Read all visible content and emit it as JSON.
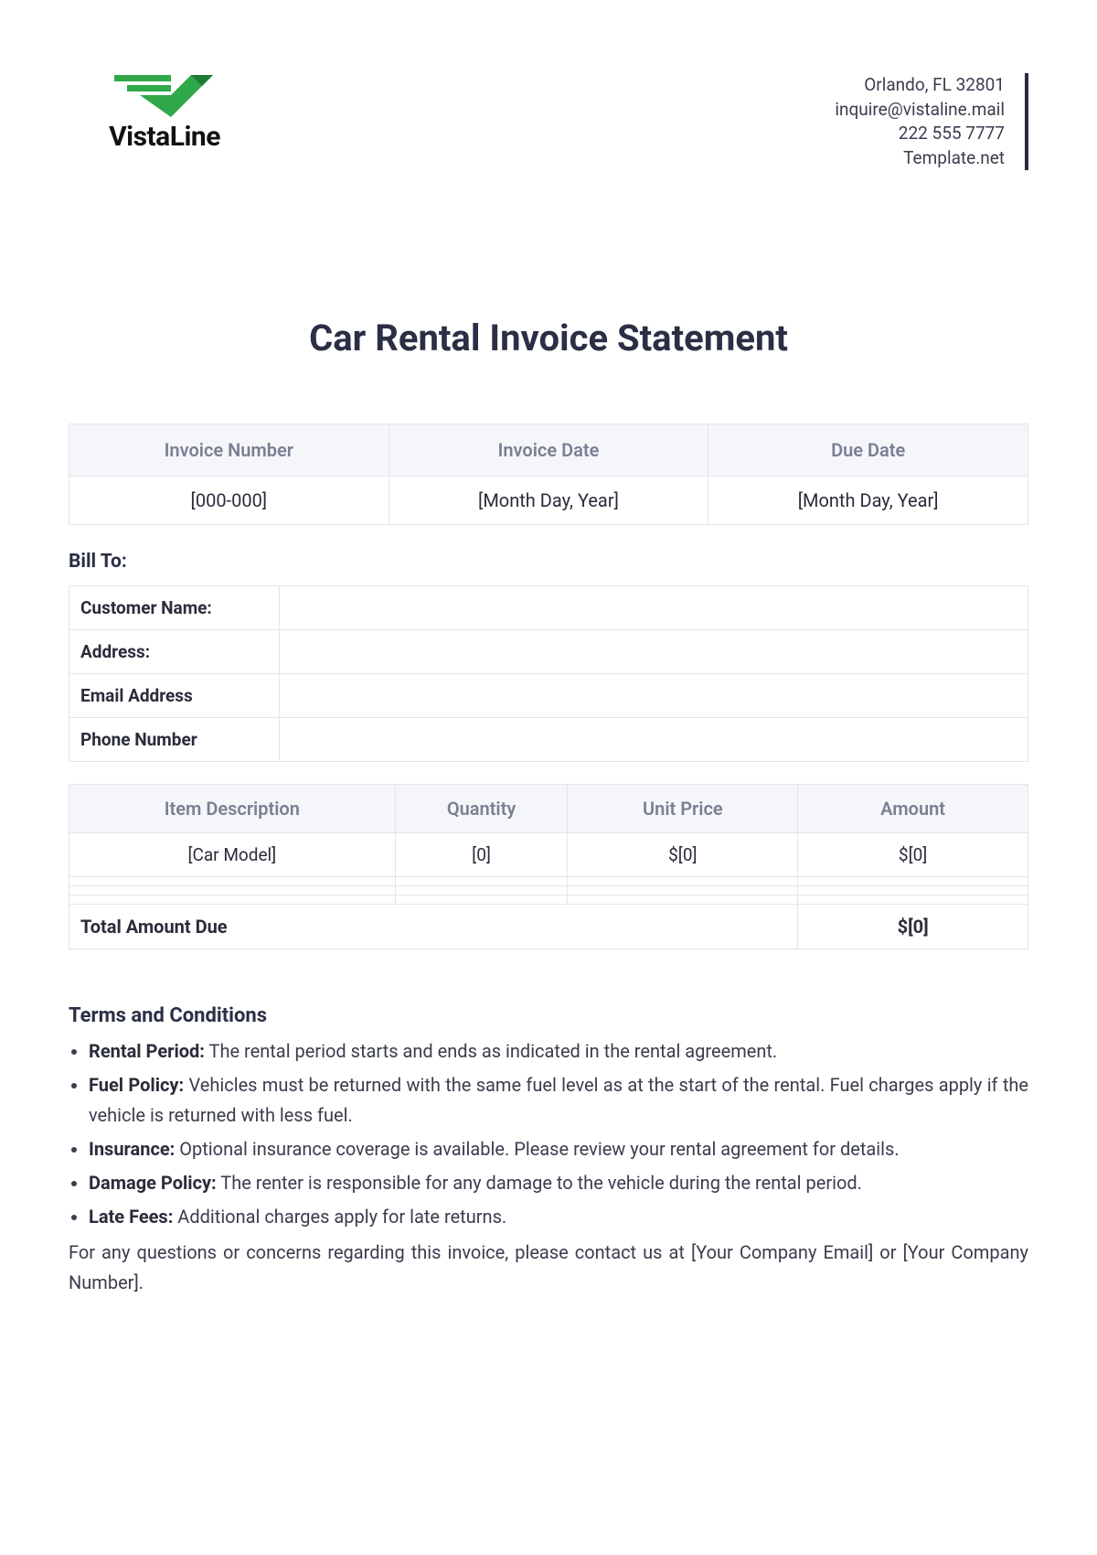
{
  "company": {
    "name": "VistaLine",
    "address": "Orlando, FL 32801",
    "email": "inquire@vistaline.mail",
    "phone": "222 555 7777",
    "site": "Template.net"
  },
  "title": "Car Rental Invoice Statement",
  "meta": {
    "headers": {
      "invoice_no": "Invoice Number",
      "invoice_date": "Invoice Date",
      "due_date": "Due Date"
    },
    "values": {
      "invoice_no": "[000-000]",
      "invoice_date": "[Month Day, Year]",
      "due_date": "[Month Day, Year]"
    }
  },
  "bill_to": {
    "heading": "Bill To:",
    "rows": [
      {
        "label": "Customer Name:",
        "value": ""
      },
      {
        "label": "Address:",
        "value": ""
      },
      {
        "label": "Email Address",
        "value": ""
      },
      {
        "label": "Phone Number",
        "value": ""
      }
    ]
  },
  "items": {
    "headers": {
      "desc": "Item Description",
      "qty": "Quantity",
      "unit": "Unit Price",
      "amount": "Amount"
    },
    "rows": [
      {
        "desc": "[Car Model]",
        "qty": "[0]",
        "unit": "$[0]",
        "amount": "$[0]"
      }
    ],
    "total_label": "Total Amount Due",
    "total_value": "$[0]"
  },
  "terms": {
    "heading": "Terms and Conditions",
    "items": [
      {
        "label": "Rental Period:",
        "text": " The rental period starts and ends as indicated in the rental agreement."
      },
      {
        "label": "Fuel Policy:",
        "text": " Vehicles must be returned with the same fuel level as at the start of the rental. Fuel charges apply if the vehicle is returned with less fuel."
      },
      {
        "label": "Insurance:",
        "text": " Optional insurance coverage is available. Please review your rental agreement for details."
      },
      {
        "label": "Damage Policy:",
        "text": " The renter is responsible for any damage to the vehicle during the rental period."
      },
      {
        "label": "Late Fees:",
        "text": " Additional charges apply for late returns."
      }
    ],
    "footer": "For any questions or concerns regarding this invoice, please contact us at [Your Company Email] or [Your Company Number]."
  }
}
